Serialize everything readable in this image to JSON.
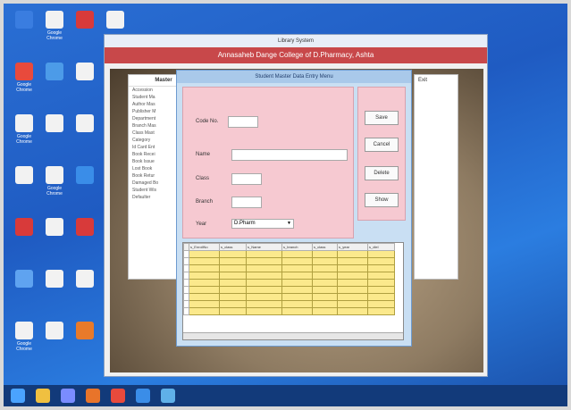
{
  "desktop": {
    "icons": [
      {
        "label": "",
        "color": "#3a7de0"
      },
      {
        "label": "Google Chrome",
        "color": "#e84a3c"
      },
      {
        "label": "Google Chrome",
        "color": "#f2f2f2"
      },
      {
        "label": "",
        "color": "#f2f2f2"
      },
      {
        "label": "",
        "color": "#d83a3a"
      },
      {
        "label": "",
        "color": "#5fa3f0"
      },
      {
        "label": "Google Chrome",
        "color": "#f2f2f2"
      },
      {
        "label": "Google Chrome",
        "color": "#f2f2f2"
      },
      {
        "label": "",
        "color": "#4c9be8"
      },
      {
        "label": "",
        "color": "#f2f2f2"
      },
      {
        "label": "Google Chrome",
        "color": "#f2f2f2"
      },
      {
        "label": "",
        "color": "#f2f2f2"
      },
      {
        "label": "",
        "color": "#f2f2f2"
      },
      {
        "label": "",
        "color": "#f2f2f2"
      },
      {
        "label": "",
        "color": "#d83a3a"
      },
      {
        "label": "",
        "color": "#f2f2f2"
      },
      {
        "label": "",
        "color": "#f2f2f2"
      },
      {
        "label": "",
        "color": "#3a8de8"
      },
      {
        "label": "",
        "color": "#d83a3a"
      },
      {
        "label": "",
        "color": "#f2f2f2"
      },
      {
        "label": "",
        "color": "#e87a2a"
      },
      {
        "label": "",
        "color": "#f2f2f2"
      },
      {
        "label": "",
        "color": "#f2f2f2"
      }
    ]
  },
  "taskbar": {
    "buttons": [
      "windows-icon",
      "search-icon",
      "task-view-icon",
      "firefox-icon",
      "chrome-icon",
      "ie-icon",
      "app-icon"
    ],
    "tray_text": ""
  },
  "library_window": {
    "title": "Library System",
    "banner": "Annasaheb Dange College of D.Pharmacy, Ashta",
    "menu_heading": "Master",
    "menu_items": [
      "Accession",
      "Student Ma",
      "Author Mas",
      "Publisher M",
      "Department",
      "Branch Mas",
      "Class Mast",
      "Category",
      "Id Card Ent",
      "Book Recei",
      "Book Issue",
      "Lost Book",
      "Book Retur",
      "Damaged Bo",
      "Student Wis",
      "Defaulter"
    ],
    "exit_label": "Exit"
  },
  "entry_window": {
    "title": "Student Master Data Entry Menu",
    "labels": {
      "code": "Code No.",
      "name": "Name",
      "class": "Class",
      "branch": "Branch",
      "year": "Year"
    },
    "values": {
      "code": "",
      "name": "",
      "class": "",
      "branch": "",
      "year": "D.Pharm"
    },
    "buttons": {
      "save": "Save",
      "cancel": "Cancel",
      "delete": "Delete",
      "show": "Show"
    },
    "grid": {
      "columns": [
        "",
        "s_EnrollNo",
        "s_class",
        "s_Name",
        "s_branch",
        "s_class",
        "s_year",
        "s_dlel"
      ],
      "rows": [
        [
          "",
          "",
          "",
          "",
          "",
          "",
          "",
          ""
        ],
        [
          "",
          "",
          "",
          "",
          "",
          "",
          "",
          ""
        ],
        [
          "",
          "",
          "",
          "",
          "",
          "",
          "",
          ""
        ],
        [
          "",
          "",
          "",
          "",
          "",
          "",
          "",
          ""
        ],
        [
          "",
          "",
          "",
          "",
          "",
          "",
          "",
          ""
        ],
        [
          "",
          "",
          "",
          "",
          "",
          "",
          "",
          ""
        ],
        [
          "",
          "",
          "",
          "",
          "",
          "",
          "",
          ""
        ],
        [
          "",
          "",
          "",
          "",
          "",
          "",
          "",
          ""
        ],
        [
          "",
          "",
          "",
          "",
          "",
          "",
          "",
          ""
        ]
      ],
      "footer": ""
    }
  }
}
